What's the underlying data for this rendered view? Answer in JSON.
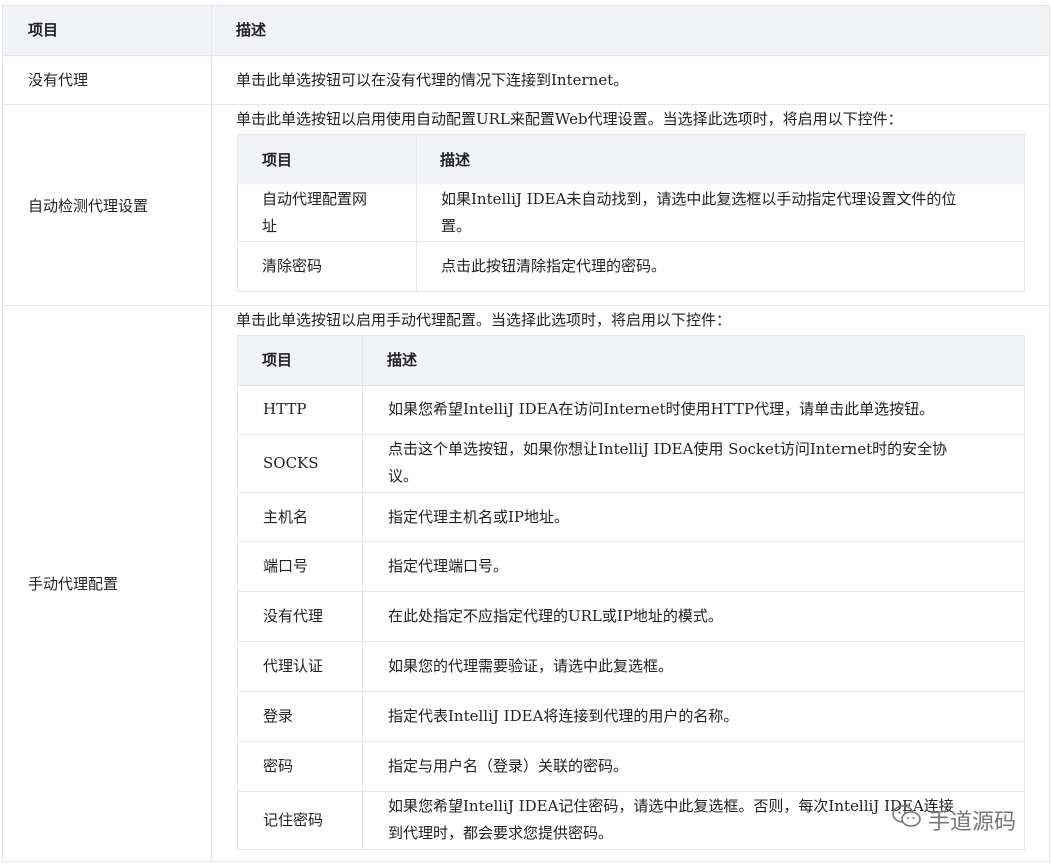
{
  "outer": {
    "headers": [
      "项目",
      "描述"
    ],
    "rows": [
      {
        "item": "没有代理",
        "desc": "单击此单选按钮可以在没有代理的情况下连接到Internet。"
      },
      {
        "item": "自动检测代理设置",
        "desc": "单击此单选按钮以启用使用自动配置URL来配置Web代理设置。当选择此选项时，将启用以下控件："
      },
      {
        "item": "手动代理配置",
        "desc": "单击此单选按钮以启用手动代理配置。当选择此选项时，将启用以下控件："
      }
    ]
  },
  "auto_table": {
    "headers": [
      "项目",
      "描述"
    ],
    "rows": [
      {
        "item": [
          "自动代理配置网",
          "址"
        ],
        "desc": [
          "如果IntelliJ IDEA未自动找到，请选中此复选框以手动指定代理设置文件的位",
          "置。"
        ]
      },
      {
        "item": [
          "清除密码"
        ],
        "desc": [
          "点击此按钮清除指定代理的密码。"
        ]
      }
    ]
  },
  "manual_table": {
    "headers": [
      "项目",
      "描述"
    ],
    "rows": [
      {
        "item": "HTTP",
        "desc": [
          "如果您希望IntelliJ IDEA在访问Internet时使用HTTP代理，请单击此单选按钮。"
        ]
      },
      {
        "item": "SOCKS",
        "desc": [
          "点击这个单选按钮，如果你想让IntelliJ IDEA使用 Socket访问Internet时的安全协",
          "议。"
        ]
      },
      {
        "item": "主机名",
        "desc": [
          "指定代理主机名或IP地址。"
        ]
      },
      {
        "item": "端口号",
        "desc": [
          "指定代理端口号。"
        ]
      },
      {
        "item": "没有代理",
        "desc": [
          "在此处指定不应指定代理的URL或IP地址的模式。"
        ]
      },
      {
        "item": "代理认证",
        "desc": [
          "如果您的代理需要验证，请选中此复选框。"
        ]
      },
      {
        "item": "登录",
        "desc": [
          "指定代表IntelliJ IDEA将连接到代理的用户的名称。"
        ]
      },
      {
        "item": "密码",
        "desc": [
          "指定与用户名（登录）关联的密码。"
        ]
      },
      {
        "item": "记住密码",
        "desc": [
          "如果您希望IntelliJ IDEA记住密码，请选中此复选框。否则，每次IntelliJ IDEA连接",
          "到代理时，都会要求您提供密码。"
        ]
      }
    ]
  },
  "watermark": {
    "icon": "wechat-icon",
    "text": "手道源码"
  }
}
